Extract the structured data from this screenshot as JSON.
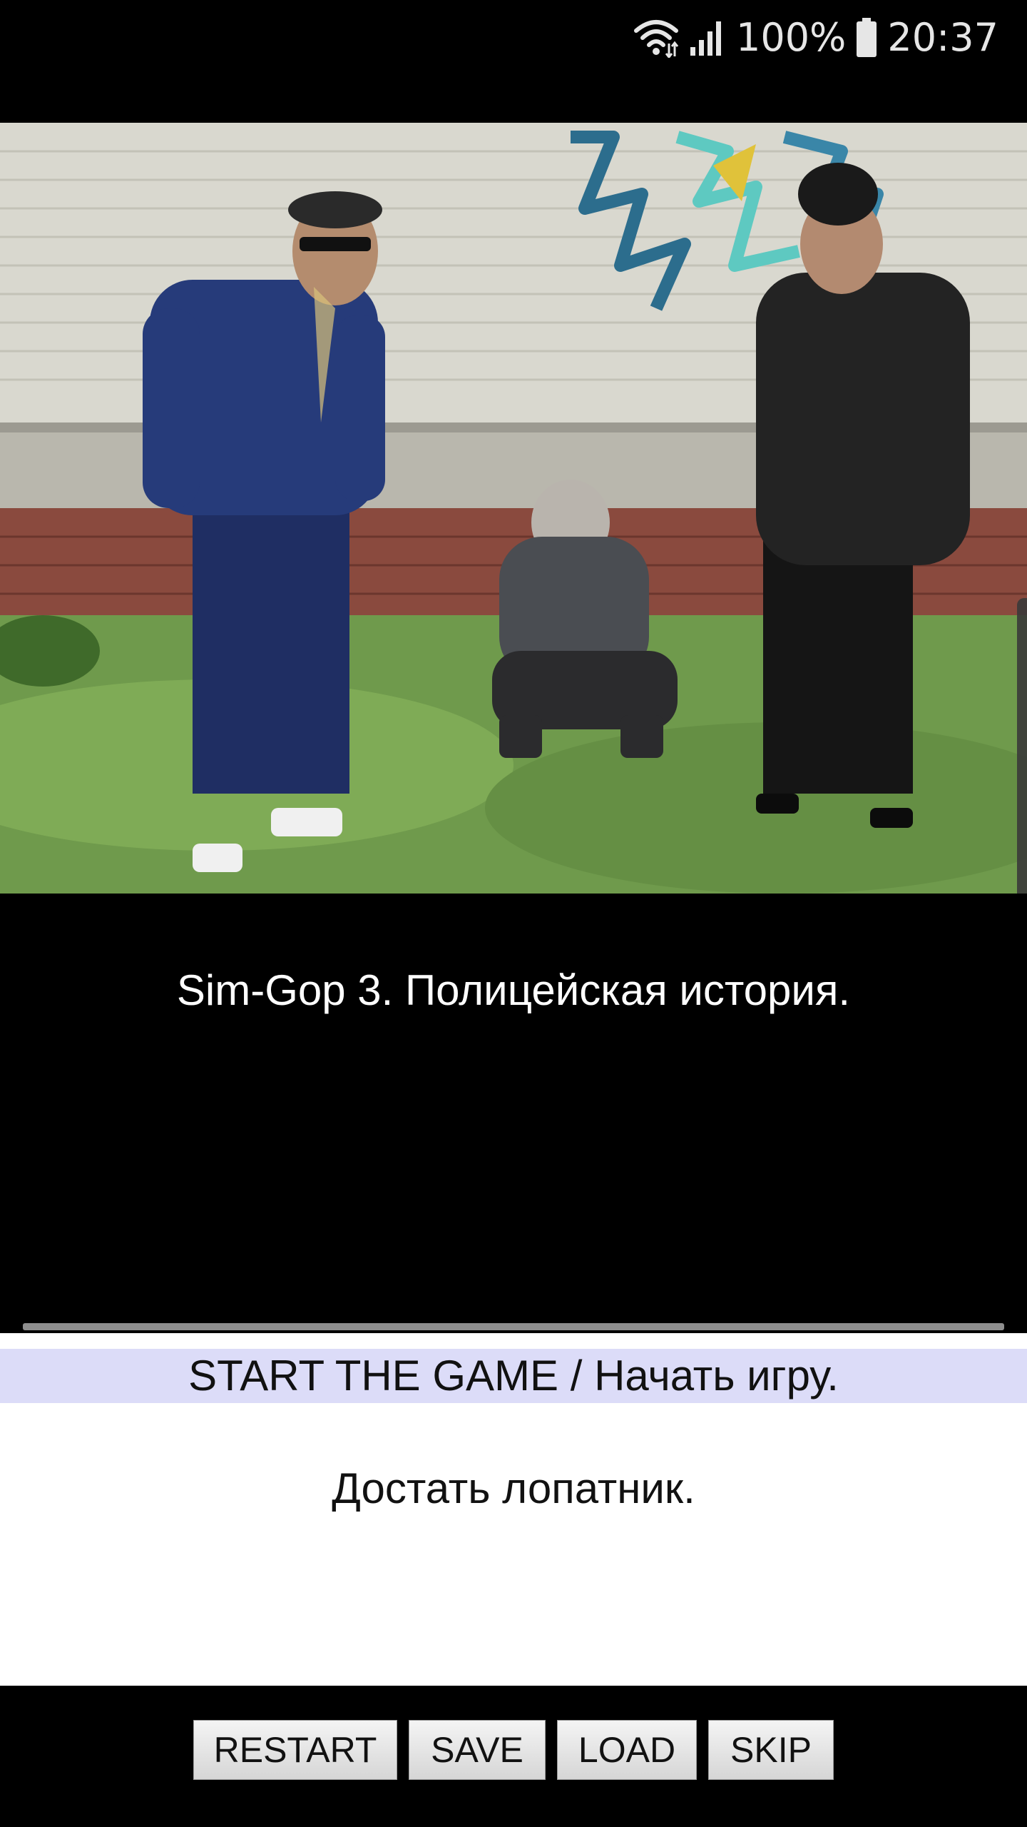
{
  "status_bar": {
    "battery": "100%",
    "time": "20:37",
    "icons": [
      "wifi-icon",
      "signal-icon",
      "battery-icon"
    ]
  },
  "scene": {
    "image": "scene-image",
    "colors": {
      "wall": "#d9d8cf",
      "grass": "#6f9a4c",
      "brick": "#8a4a3e"
    }
  },
  "story": {
    "text": "Sim-Gop 3. Полицейская история."
  },
  "choices": [
    {
      "label": "START THE GAME / Начать игру."
    },
    {
      "label": "Достать лопатник."
    }
  ],
  "colors": {
    "choice_highlight": "#dcdcf8",
    "background": "#000000",
    "story_text": "#ffffff"
  },
  "buttons": {
    "restart": "RESTART",
    "save": "SAVE",
    "load": "LOAD",
    "skip": "SKIP"
  }
}
